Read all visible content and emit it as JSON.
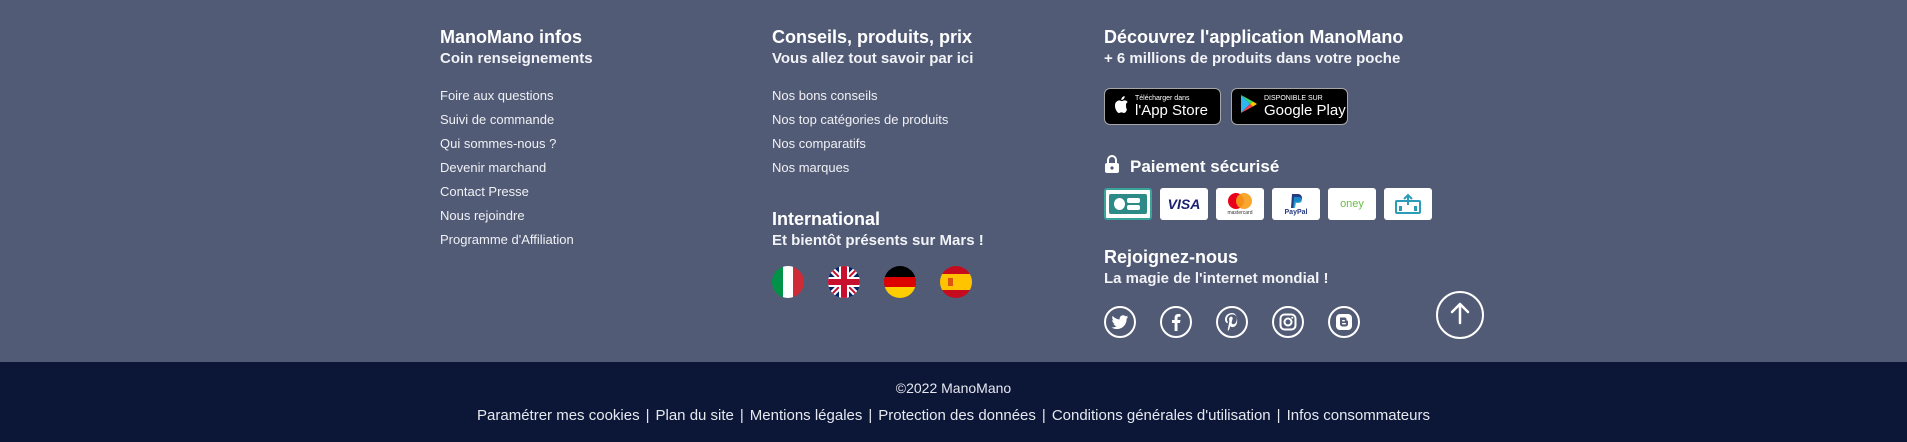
{
  "infos": {
    "title": "ManoMano infos",
    "subtitle": "Coin renseignements",
    "links": [
      "Foire aux questions",
      "Suivi de commande",
      "Qui sommes-nous ?",
      "Devenir marchand",
      "Contact Presse",
      "Nous rejoindre",
      "Programme d'Affiliation"
    ]
  },
  "conseils": {
    "title": "Conseils, produits, prix",
    "subtitle": "Vous allez tout savoir par ici",
    "links": [
      "Nos bons conseils",
      "Nos top catégories de produits",
      "Nos comparatifs",
      "Nos marques"
    ]
  },
  "international": {
    "title": "International",
    "subtitle": "Et bientôt présents sur Mars !",
    "flags": [
      "italy-flag-icon",
      "uk-flag-icon",
      "germany-flag-icon",
      "spain-flag-icon"
    ]
  },
  "app": {
    "title": "Découvrez l'application ManoMano",
    "subtitle": "+ 6 millions de produits dans votre poche",
    "appstore_small": "Télécharger dans",
    "appstore_big": "l'App Store",
    "googleplay_small": "DISPONIBLE SUR",
    "googleplay_big": "Google Play"
  },
  "payment": {
    "title": "Paiement sécurisé",
    "cards": [
      "CB",
      "VISA",
      "mastercard",
      "PayPal",
      "oney",
      "virement"
    ]
  },
  "join": {
    "title": "Rejoignez-nous",
    "subtitle": "La magie de l'internet mondial !"
  },
  "footer": {
    "copyright": "©2022 ManoMano",
    "links": [
      "Paramétrer mes cookies",
      "Plan du site",
      "Mentions légales",
      "Protection des données",
      "Conditions générales d'utilisation",
      "Infos consommateurs"
    ]
  },
  "colors": {
    "top_bg": "#525b76",
    "bottom_bg": "#0c1738"
  }
}
